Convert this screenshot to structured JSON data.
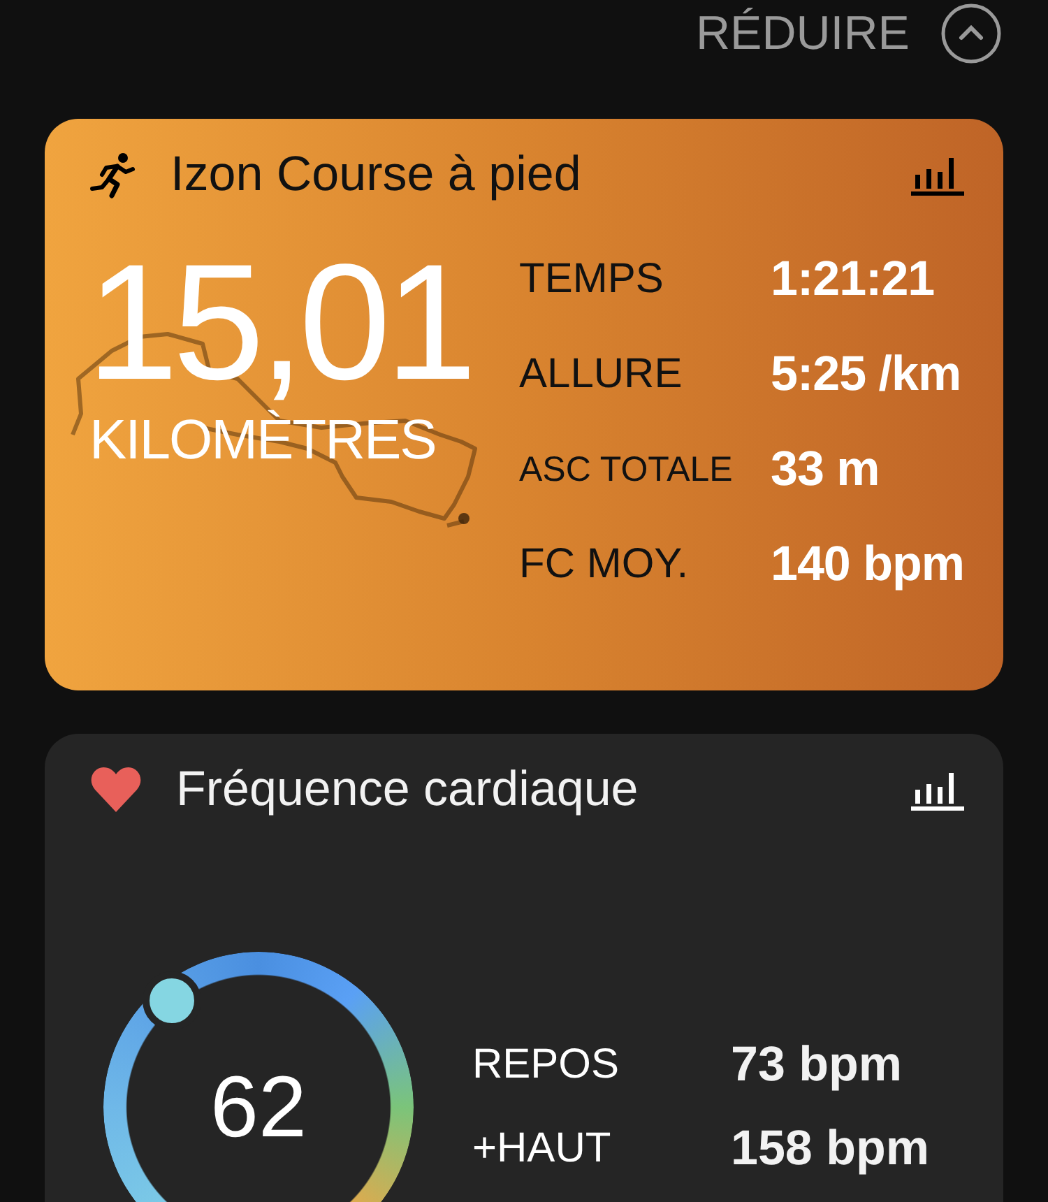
{
  "collapse": {
    "label": "RÉDUIRE"
  },
  "activity": {
    "title": "Izon Course à pied",
    "distance": "15,01",
    "unit": "KILOMÈTRES",
    "stats": [
      {
        "label": "TEMPS",
        "value": "1:21:21"
      },
      {
        "label": "ALLURE",
        "value": "5:25 /km"
      },
      {
        "label": "ASC TOTALE",
        "value": "33 m",
        "kind": "small"
      },
      {
        "label": "FC MOY.",
        "value": "140 bpm"
      }
    ]
  },
  "heart_rate": {
    "title": "Fréquence cardiaque",
    "current": "62",
    "stats": [
      {
        "label": "REPOS",
        "value": "73 bpm"
      },
      {
        "label": "+HAUT",
        "value": "158 bpm"
      }
    ]
  }
}
